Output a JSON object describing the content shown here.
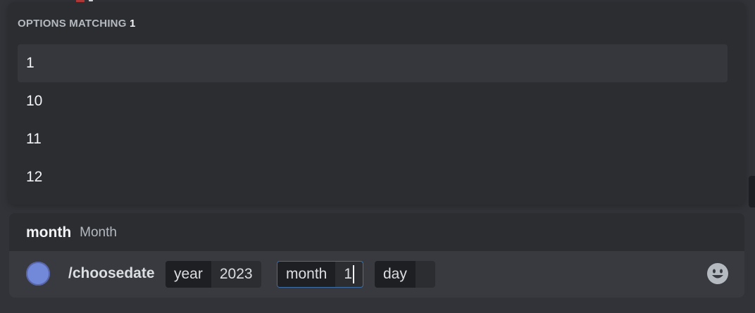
{
  "autocomplete": {
    "header_prefix": "OPTIONS MATCHING",
    "query": "1",
    "options": [
      "1",
      "10",
      "11",
      "12"
    ],
    "selected_index": 0
  },
  "option_hint": {
    "name": "month",
    "description": "Month"
  },
  "command": {
    "name": "/choosedate",
    "options": [
      {
        "label": "year",
        "value": "2023",
        "active": false
      },
      {
        "label": "month",
        "value": "1",
        "active": true
      },
      {
        "label": "day",
        "value": "",
        "active": false
      }
    ]
  },
  "icons": {
    "bot_avatar": "bot-avatar",
    "emoji": "smiley-face-icon"
  },
  "colors": {
    "background": "#313338",
    "popup": "#2b2d31",
    "input": "#383a40",
    "active_border": "#3e6fa8",
    "avatar": "#7289da"
  }
}
